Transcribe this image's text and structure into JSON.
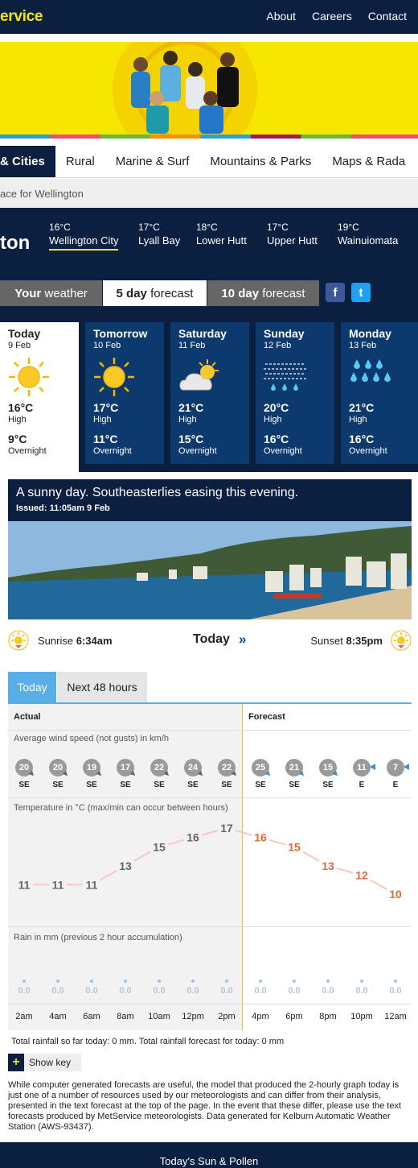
{
  "header": {
    "brand": "ervice",
    "nav": [
      "About",
      "Careers",
      "Contact"
    ]
  },
  "category_tabs": [
    "& Cities",
    "Rural",
    "Marine & Surf",
    "Mountains & Parks",
    "Maps & Rada"
  ],
  "breadcrumb": "ace for Wellington",
  "location": {
    "name": "ton",
    "suburbs": [
      {
        "temp": "16°C",
        "name": "Wellington City"
      },
      {
        "temp": "17°C",
        "name": "Lyall Bay"
      },
      {
        "temp": "18°C",
        "name": "Lower Hutt"
      },
      {
        "temp": "17°C",
        "name": "Upper Hutt"
      },
      {
        "temp": "19°C",
        "name": "Wainuiomata"
      }
    ]
  },
  "forecast_tabs": [
    {
      "bold": "Your",
      "rest": " weather"
    },
    {
      "bold": "5 day",
      "rest": " forecast"
    },
    {
      "bold": "10 day",
      "rest": " forecast"
    }
  ],
  "social": {
    "facebook": "f",
    "twitter": "t"
  },
  "days": [
    {
      "name": "Today",
      "date": "9 Feb",
      "icon": "sun-icon",
      "high": "16°C",
      "high_label": "High",
      "low": "9°C",
      "low_label": "Overnight"
    },
    {
      "name": "Tomorrow",
      "date": "10 Feb",
      "icon": "sun-icon",
      "high": "17°C",
      "high_label": "High",
      "low": "11°C",
      "low_label": "Overnight"
    },
    {
      "name": "Saturday",
      "date": "11 Feb",
      "icon": "partly-cloudy-icon",
      "high": "21°C",
      "high_label": "High",
      "low": "15°C",
      "low_label": "Overnight"
    },
    {
      "name": "Sunday",
      "date": "12 Feb",
      "icon": "fog-drizzle-icon",
      "high": "20°C",
      "high_label": "High",
      "low": "16°C",
      "low_label": "Overnight"
    },
    {
      "name": "Monday",
      "date": "13 Feb",
      "icon": "rain-icon",
      "high": "21°C",
      "high_label": "High",
      "low": "16°C",
      "low_label": "Overnight"
    }
  ],
  "summary": {
    "text": "A sunny day. Southeasterlies easing this evening.",
    "issued": "Issued: 11:05am 9 Feb"
  },
  "sun": {
    "sunrise_label": "Sunrise ",
    "sunrise_time": "6:34am",
    "today": "Today",
    "arrow": "»",
    "sunset_label": "Sunset ",
    "sunset_time": "8:35pm"
  },
  "graph_tabs": [
    "Today",
    "Next 48 hours"
  ],
  "graph": {
    "actual_label": "Actual",
    "forecast_label": "Forecast",
    "wind_title": "Average wind speed (not gusts) in km/h",
    "temp_title": "Temperature in °C (max/min can occur between hours)",
    "rain_title": "Rain in mm (previous 2 hour accumulation)",
    "times": [
      "2am",
      "4am",
      "6am",
      "8am",
      "10am",
      "12pm",
      "2pm",
      "4pm",
      "6pm",
      "8pm",
      "10pm",
      "12am"
    ],
    "wind_speed": [
      "20",
      "20",
      "19",
      "17",
      "22",
      "24",
      "22",
      "25",
      "21",
      "15",
      "11",
      "7"
    ],
    "wind_dir": [
      "SE",
      "SE",
      "SE",
      "SE",
      "SE",
      "SE",
      "SE",
      "SE",
      "SE",
      "SE",
      "E",
      "E"
    ],
    "temps": [
      11,
      11,
      11,
      13,
      15,
      16,
      17,
      16,
      15,
      13,
      12,
      10
    ],
    "rain": [
      "0.0",
      "0.0",
      "0.0",
      "0.0",
      "0.0",
      "0.0",
      "0.0",
      "0.0",
      "0.0",
      "0.0",
      "0.0",
      "0.0"
    ],
    "actual_count": 7
  },
  "colors": {
    "navy": "#0b2040",
    "card": "#0d3a6e",
    "yellow": "#f5e21a",
    "actual_temp": "#666666",
    "forecast_temp": "#e8683a"
  },
  "totals": "Total rainfall so far today: 0 mm. Total rainfall forecast for today: 0 mm",
  "show_key": "Show key",
  "show_key_plus": "+",
  "disclaimer": "While computer generated forecasts are useful, the model that produced the 2-hourly graph today is just one of a number of resources used by our meteorologists and can differ from their analysis, presented in the text forecast at the top of the page. In the event that these differ, please use the text forecasts produced by MetService meteorologists. Data generated for Kelburn Automatic Weather Station (AWS-93437).",
  "footer": "Today's Sun & Pollen"
}
